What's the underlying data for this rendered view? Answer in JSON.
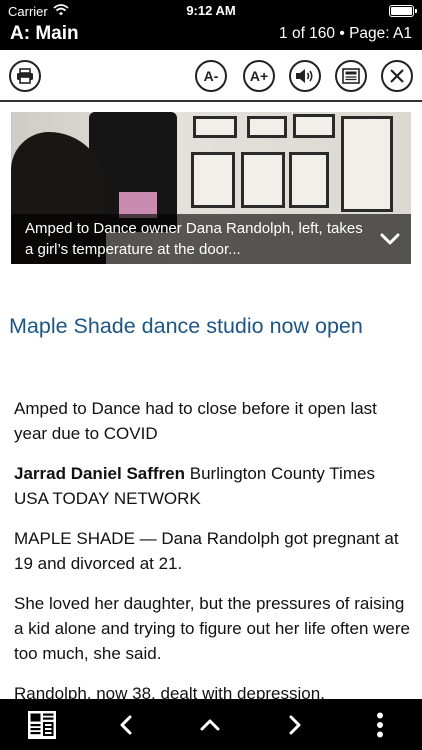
{
  "status_bar": {
    "carrier": "Carrier",
    "time": "9:12 AM"
  },
  "header": {
    "section": "A: Main",
    "page_indicator": "1 of 160 • Page: A1"
  },
  "toolbar": {
    "icons": [
      "printer-icon",
      "decrease-text-icon",
      "increase-text-icon",
      "speaker-icon",
      "newspaper-icon",
      "close-icon"
    ],
    "font_decrease_label": "A-",
    "font_increase_label": "A+"
  },
  "photo": {
    "caption": "Amped to Dance owner Dana Randolph, left, takes a girl’s temperature at the door..."
  },
  "article": {
    "headline": "Maple Shade dance studio now open",
    "subhead": "Amped to Dance had to close before it open last year due to COVID",
    "byline_name": "Jarrad Daniel Saffren",
    "byline_rest": " Burlington County Times USA TODAY NETWORK",
    "paragraphs": [
      "MAPLE SHADE — Dana Randolph got pregnant at 19 and divorced at 21.",
      "She loved her daughter, but the pressures of raising a kid alone and trying to figure out her life often were too much, she said.",
      "Randolph, now 38, dealt with depression."
    ]
  },
  "bottom_bar": {
    "icons": [
      "page-thumbnails-icon",
      "previous-arrow-icon",
      "up-arrow-icon",
      "next-arrow-icon",
      "more-vertical-icon"
    ]
  }
}
